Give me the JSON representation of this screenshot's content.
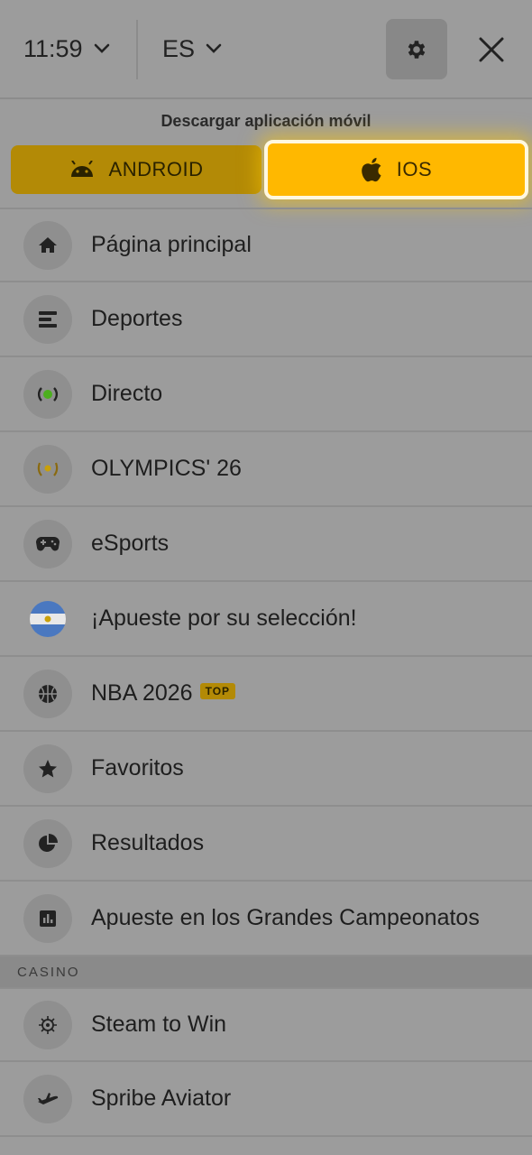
{
  "header": {
    "time": "11:59",
    "language": "ES"
  },
  "download": {
    "title": "Descargar aplicación móvil",
    "android_label": "ANDROID",
    "ios_label": "IOS"
  },
  "menu": {
    "items": [
      {
        "label": "Página principal",
        "icon": "home-icon"
      },
      {
        "label": "Deportes",
        "icon": "sports-list-icon"
      },
      {
        "label": "Directo",
        "icon": "live-icon"
      },
      {
        "label": "OLYMPICS' 26",
        "icon": "laurel-icon"
      },
      {
        "label": "eSports",
        "icon": "gamepad-icon"
      },
      {
        "label": "¡Apueste por su selección!",
        "icon": "argentina-flag-icon"
      },
      {
        "label": "NBA 2026",
        "icon": "basketball-icon",
        "badge": "TOP"
      },
      {
        "label": "Favoritos",
        "icon": "star-icon"
      },
      {
        "label": "Resultados",
        "icon": "pie-chart-icon"
      },
      {
        "label": "Apueste en los Grandes Campeonatos",
        "icon": "bar-chart-icon"
      }
    ]
  },
  "casino": {
    "header": "CASINO",
    "items": [
      {
        "label": "Steam to Win",
        "icon": "compass-icon"
      },
      {
        "label": "Spribe Aviator",
        "icon": "plane-icon"
      }
    ]
  },
  "colors": {
    "accent": "#ffb800",
    "accent_dim": "#b38a06",
    "overlay_bg": "#9c9c9c"
  }
}
